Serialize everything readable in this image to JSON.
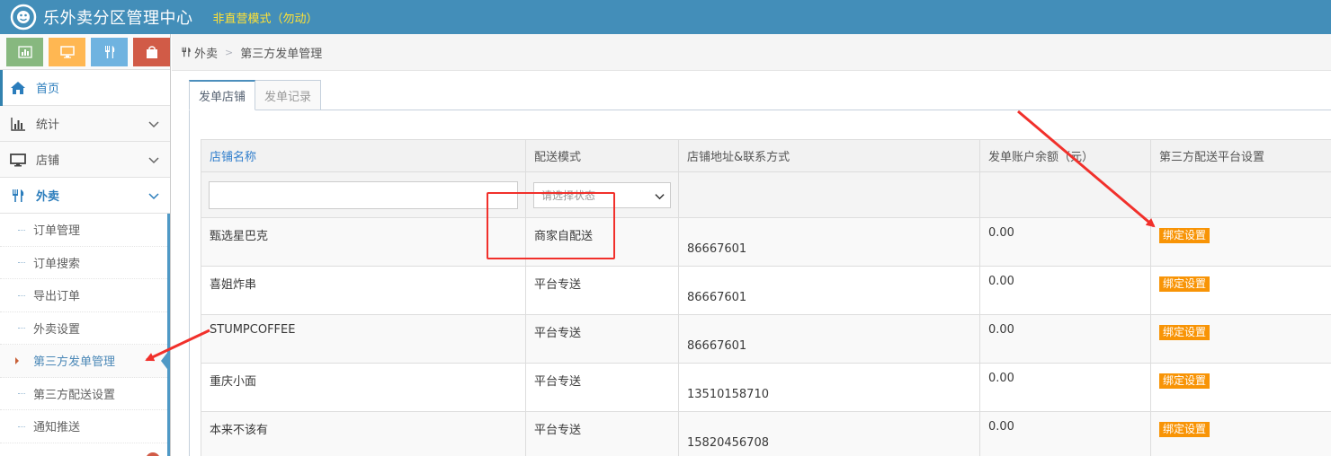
{
  "header": {
    "title": "乐外卖分区管理中心",
    "mode": "非直营模式（勿动）"
  },
  "shortcuts": [
    {
      "icon": "bar-chart-icon",
      "color": "#87b87f"
    },
    {
      "icon": "monitor-icon",
      "color": "#ffb752"
    },
    {
      "icon": "utensils-icon",
      "color": "#6fb3e0"
    },
    {
      "icon": "bag-icon",
      "color": "#d15b47"
    }
  ],
  "sidebar": {
    "home": "首页",
    "stats": "统计",
    "shops": "店铺",
    "takeout": "外卖",
    "submenu": [
      "订单管理",
      "订单搜索",
      "导出订单",
      "外卖设置",
      "第三方发单管理",
      "第三方配送设置",
      "通知推送",
      "……"
    ]
  },
  "breadcrumb": {
    "parent": "外卖",
    "current": "第三方发单管理"
  },
  "tabs": [
    "发单店铺",
    "发单记录"
  ],
  "table": {
    "headers": [
      "店铺名称",
      "配送模式",
      "店铺地址&联系方式",
      "发单账户余额（元）",
      "第三方配送平台设置"
    ],
    "filter": {
      "search_value": "",
      "select_placeholder": "请选择状态"
    },
    "rows": [
      {
        "name": "甄选星巴克",
        "mode": "商家自配送",
        "contact": "86667601",
        "balance": "0.00",
        "action": "绑定设置"
      },
      {
        "name": "喜姐炸串",
        "mode": "平台专送",
        "contact": "86667601",
        "balance": "0.00",
        "action": "绑定设置"
      },
      {
        "name": "STUMPCOFFEE",
        "mode": "平台专送",
        "contact": "86667601",
        "balance": "0.00",
        "action": "绑定设置"
      },
      {
        "name": "重庆小面",
        "mode": "平台专送",
        "contact": "13510158710",
        "balance": "0.00",
        "action": "绑定设置"
      },
      {
        "name": "本来不该有",
        "mode": "平台专送",
        "contact": "15820456708",
        "balance": "0.00",
        "action": "绑定设置"
      }
    ]
  },
  "colors": {
    "topbar": "#438eb9",
    "accent": "#2b7dbc",
    "bind_button": "#f89406",
    "annotation": "#f1302b"
  }
}
